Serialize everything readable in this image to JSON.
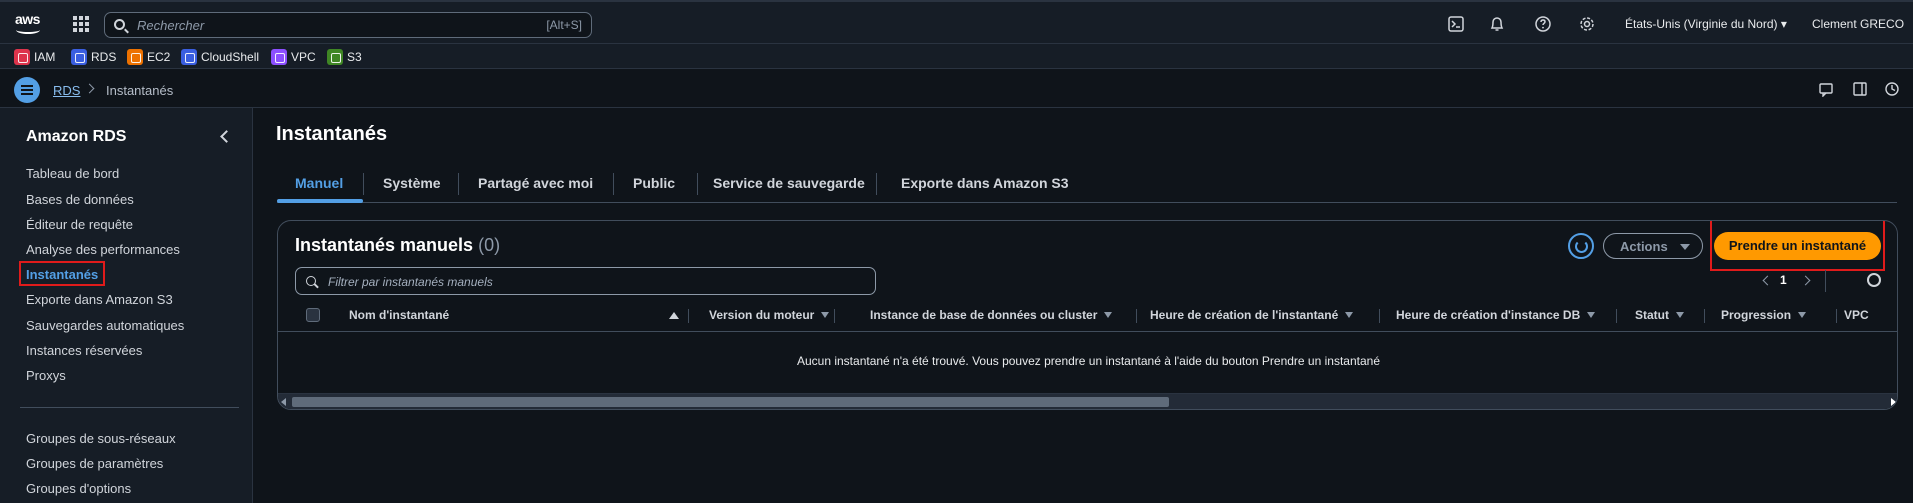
{
  "topbar": {
    "logo_text": "aws",
    "search_placeholder": "Rechercher",
    "search_shortcut": "[Alt+S]",
    "region": "États-Unis (Virginie du Nord)",
    "user": "Clement GRECO",
    "icons": [
      "cloudshell-icon",
      "bell-icon",
      "help-icon",
      "gear-icon"
    ]
  },
  "favorites": [
    {
      "label": "IAM",
      "color": "#dd344c"
    },
    {
      "label": "RDS",
      "color": "#3a5ee0"
    },
    {
      "label": "EC2",
      "color": "#ed7100"
    },
    {
      "label": "CloudShell",
      "color": "#3a5ee0"
    },
    {
      "label": "VPC",
      "color": "#8c4fff"
    },
    {
      "label": "S3",
      "color": "#3f8624"
    }
  ],
  "breadcrumb": {
    "link": "RDS",
    "current": "Instantanés"
  },
  "sidebar": {
    "title": "Amazon RDS",
    "items": [
      "Tableau de bord",
      "Bases de données",
      "Éditeur de requête",
      "Analyse des performances",
      "Instantanés",
      "Exporte dans Amazon S3",
      "Sauvegardes automatiques",
      "Instances réservées",
      "Proxys"
    ],
    "items2": [
      "Groupes de sous-réseaux",
      "Groupes de paramètres",
      "Groupes d'options"
    ]
  },
  "main": {
    "title": "Instantanés",
    "tabs": [
      "Manuel",
      "Système",
      "Partagé avec moi",
      "Public",
      "Service de sauvegarde",
      "Exporte dans Amazon S3"
    ],
    "panel": {
      "title": "Instantanés manuels",
      "count": "(0)",
      "actions_label": "Actions",
      "primary_label": "Prendre un instantané",
      "filter_placeholder": "Filtrer par instantanés manuels",
      "page": "1",
      "columns": [
        "Nom d'instantané",
        "Version du moteur",
        "Instance de base de données ou cluster",
        "Heure de création de l'instantané",
        "Heure de création d'instance DB",
        "Statut",
        "Progression",
        "VPC"
      ],
      "empty_message": "Aucun instantané n'a été trouvé. Vous pouvez prendre un instantané à l'aide du bouton Prendre un instantané"
    }
  },
  "colors": {
    "accent": "#539fe5",
    "primary_button": "#ff9900",
    "highlight_box": "#e01b1b",
    "background": "#0f141a",
    "nav_background": "#161d26"
  }
}
